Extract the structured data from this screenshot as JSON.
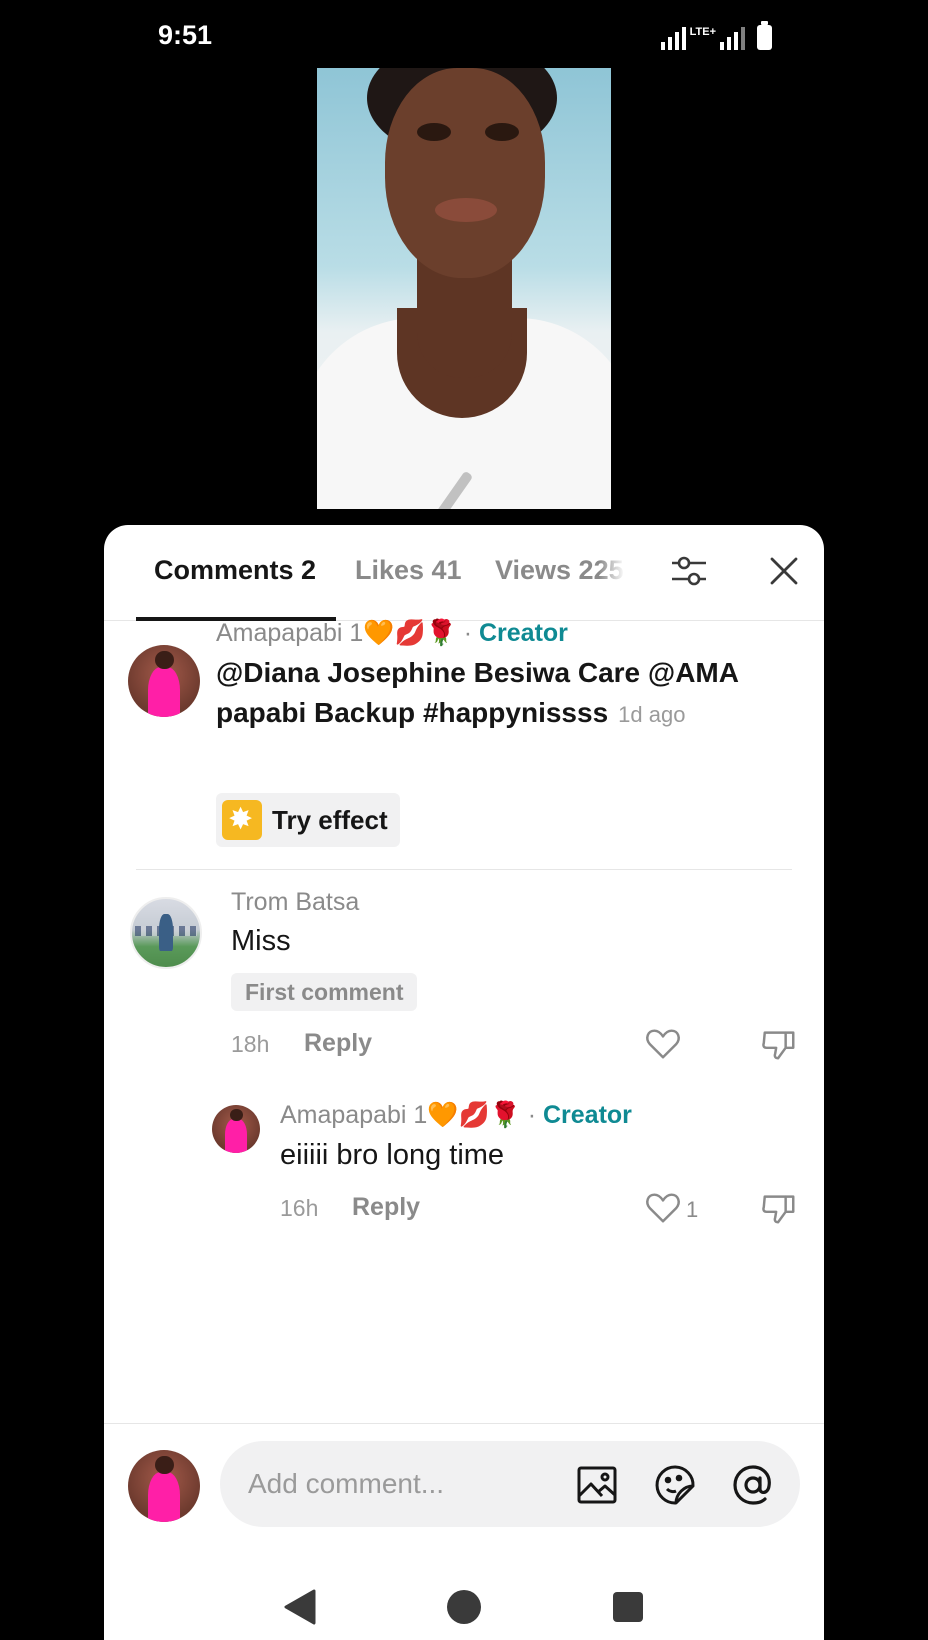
{
  "status_bar": {
    "time": "9:51",
    "network": "LTE+"
  },
  "tabs": [
    {
      "label": "Comments 2",
      "active": true
    },
    {
      "label": "Likes 41",
      "active": false
    },
    {
      "label": "Views 225",
      "active": false
    }
  ],
  "post": {
    "author": "Amapapabi 1",
    "author_emoji": [
      "🧡",
      "💋",
      "🌹"
    ],
    "separator": "·",
    "creator_label": "Creator",
    "caption": "@Diana Josephine Besiwa Care @AMA papabi Backup #happynissss",
    "time": "1d ago",
    "try_effect_label": "Try effect"
  },
  "comments": [
    {
      "author": "Trom Batsa",
      "text": "Miss",
      "badge": "First comment",
      "time": "18h",
      "reply_label": "Reply",
      "likes": ""
    },
    {
      "author": "Amapapabi 1",
      "author_emoji": [
        "🧡",
        "💋",
        "🌹"
      ],
      "separator": "·",
      "creator_label": "Creator",
      "text": "eiiiii bro long time",
      "time": "16h",
      "reply_label": "Reply",
      "likes": "1"
    }
  ],
  "composer": {
    "placeholder": "Add comment..."
  },
  "icons": {
    "filter": "filter-sliders-icon",
    "close": "close-icon",
    "like": "heart-outline-icon",
    "dislike": "thumbs-down-icon",
    "image": "image-icon",
    "sticker": "sticker-icon",
    "mention": "at-mention-icon",
    "nav_back": "back-triangle-icon",
    "nav_home": "home-circle-icon",
    "nav_recents": "recents-square-icon"
  },
  "colors": {
    "creator": "#0f8a93",
    "panel_bg": "#ffffff",
    "effect_icon": "#f6b821"
  }
}
